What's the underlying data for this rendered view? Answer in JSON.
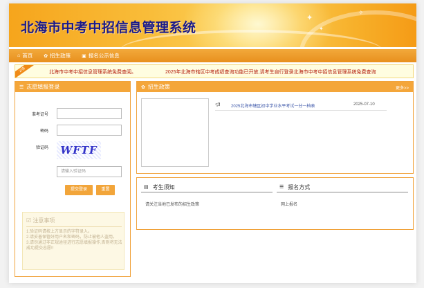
{
  "header": {
    "title": "北海市中考中招信息管理系统"
  },
  "nav": {
    "items": [
      {
        "icon": "home-icon",
        "glyph": "⌂",
        "label": "首页"
      },
      {
        "icon": "gear-icon",
        "glyph": "✿",
        "label": "招生政策"
      },
      {
        "icon": "image-icon",
        "glyph": "▣",
        "label": "报名公示信息"
      }
    ]
  },
  "notice": {
    "tag": "公告",
    "messages": [
      "北海市中考中招信息管理系统免费查阅。",
      "2025年北海市辖区中考成绩查询功能已开放,请考生自行登录北海市中考中招信息管理系统免费查询"
    ]
  },
  "login": {
    "title": "志愿填报登录",
    "fields": {
      "exam_no_label": "准考证号",
      "password_label": "密码",
      "captcha_label": "验证码",
      "captcha_text": "WFTF",
      "captcha_placeholder": "请输入验证码"
    },
    "submit_label": "提交登录",
    "reset_label": "重置"
  },
  "tips": {
    "title": "注意事项",
    "lines": [
      "1.验证码请按上方显示的字符录入。",
      "2.请妥善保管好用户名和密码，防止被他人盗用。",
      "3.请勿通过非正规途径进行志愿填报操作,否则将无法成功提交志愿!!"
    ]
  },
  "policy": {
    "title": "招生政策",
    "more_label": "更多>>",
    "news": [
      {
        "title": "2025北海市辖区初中学业水平考试一分一档表",
        "date": "2025-07-10"
      }
    ]
  },
  "info": {
    "notice_col": {
      "title": "考生须知",
      "content": "请关注当地已发布的招生政策"
    },
    "signup_col": {
      "title": "报名方式",
      "content": "网上报名"
    }
  },
  "colors": {
    "accent": "#f4a63a",
    "title": "#1a1a8a",
    "notice_text": "#b21a0a",
    "link": "#3a55a8"
  }
}
